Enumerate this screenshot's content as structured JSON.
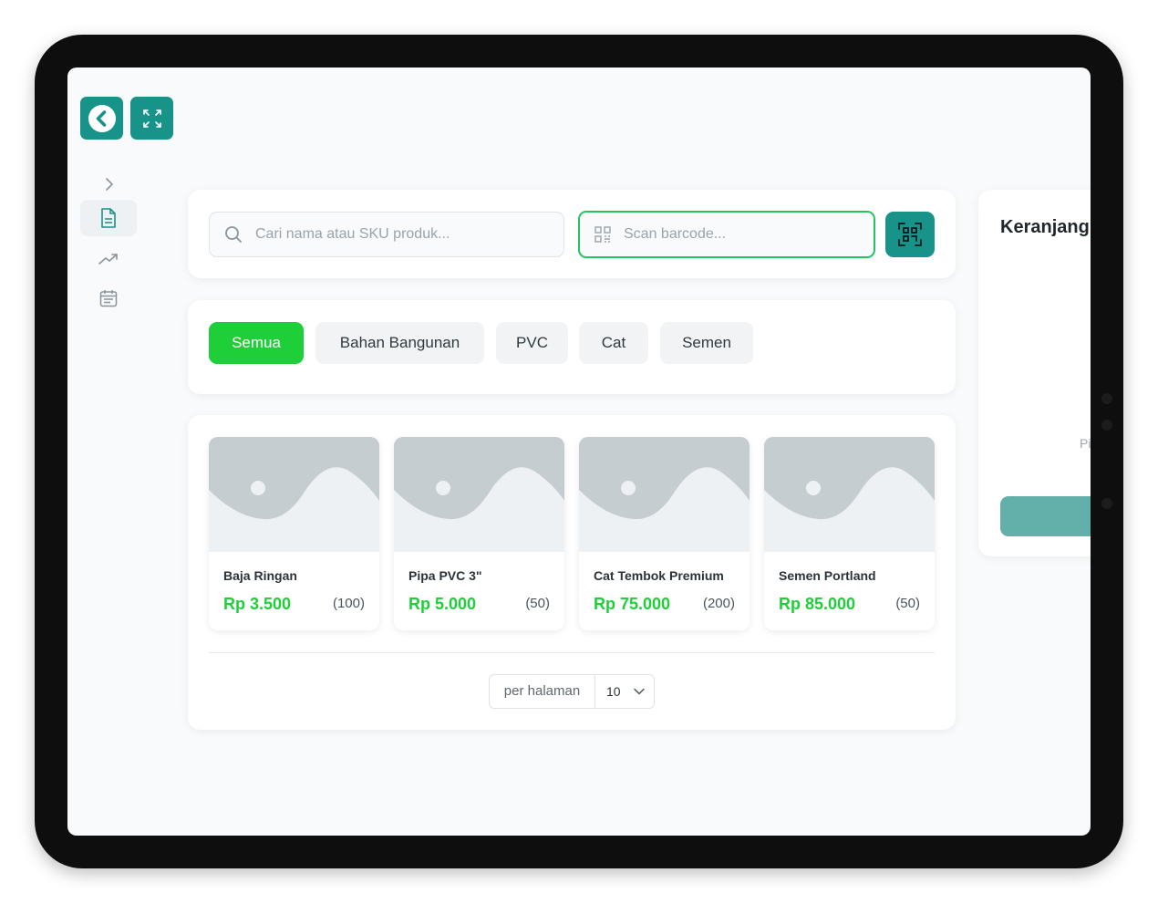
{
  "toolbar": {
    "back_icon": "back-arrow-icon",
    "fullscreen_icon": "fullscreen-icon"
  },
  "sidebar": {
    "items": [
      "chevron-right-icon",
      "document-icon",
      "trending-up-icon",
      "calendar-icon"
    ]
  },
  "search": {
    "placeholder": "Cari nama atau SKU produk...",
    "barcode_placeholder": "Scan barcode..."
  },
  "categories": [
    "Semua",
    "Bahan Bangunan",
    "PVC",
    "Cat",
    "Semen"
  ],
  "products": [
    {
      "name": "Baja Ringan",
      "price": "Rp 3.500",
      "stock": "(100)"
    },
    {
      "name": "Pipa PVC 3\"",
      "price": "Rp 5.000",
      "stock": "(50)"
    },
    {
      "name": "Cat Tembok Premium",
      "price": "Rp 75.000",
      "stock": "(200)"
    },
    {
      "name": "Semen Portland",
      "price": "Rp 85.000",
      "stock": "(50)"
    }
  ],
  "pagination": {
    "label": "per halaman",
    "value": "10"
  },
  "cart": {
    "title": "Keranjang",
    "hint": "Pi"
  },
  "colors": {
    "primary": "#17938a",
    "accent_green": "#1ecf3a",
    "focus_border": "#22c55e"
  }
}
